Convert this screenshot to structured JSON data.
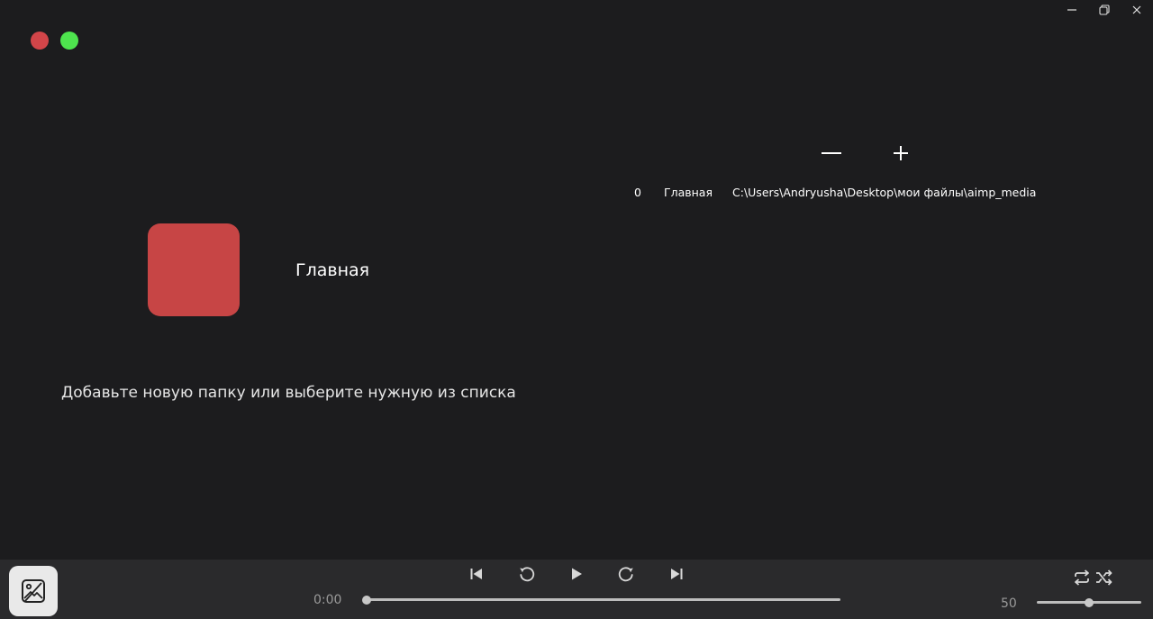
{
  "window": {
    "controls": [
      "minimize-icon",
      "restore-icon",
      "close-icon"
    ]
  },
  "colors": {
    "background": "#1c1c1e",
    "player_bar": "#2a2a2c",
    "dot_red": "#d24549",
    "dot_green": "#4ee44e",
    "cover": "#c74545"
  },
  "folders": {
    "remove_icon": "minus-icon",
    "add_icon": "plus-icon",
    "items": [
      {
        "index": "0",
        "name": "Главная",
        "path": "C:\\Users\\Andryusha\\Desktop\\мои файлы\\aimp_media"
      }
    ]
  },
  "current_folder": {
    "title": "Главная"
  },
  "hint": "Добавьте новую папку или выберите нужную из списка",
  "player": {
    "time": "0:00",
    "progress": 0,
    "volume_label": "50",
    "volume": 0.5,
    "icons": {
      "art": "image-icon",
      "prev": "skip-previous-icon",
      "back": "rewind-icon",
      "play": "play-icon",
      "forward": "fast-forward-icon",
      "next": "skip-next-icon",
      "repeat": "repeat-icon",
      "shuffle": "shuffle-icon"
    }
  }
}
